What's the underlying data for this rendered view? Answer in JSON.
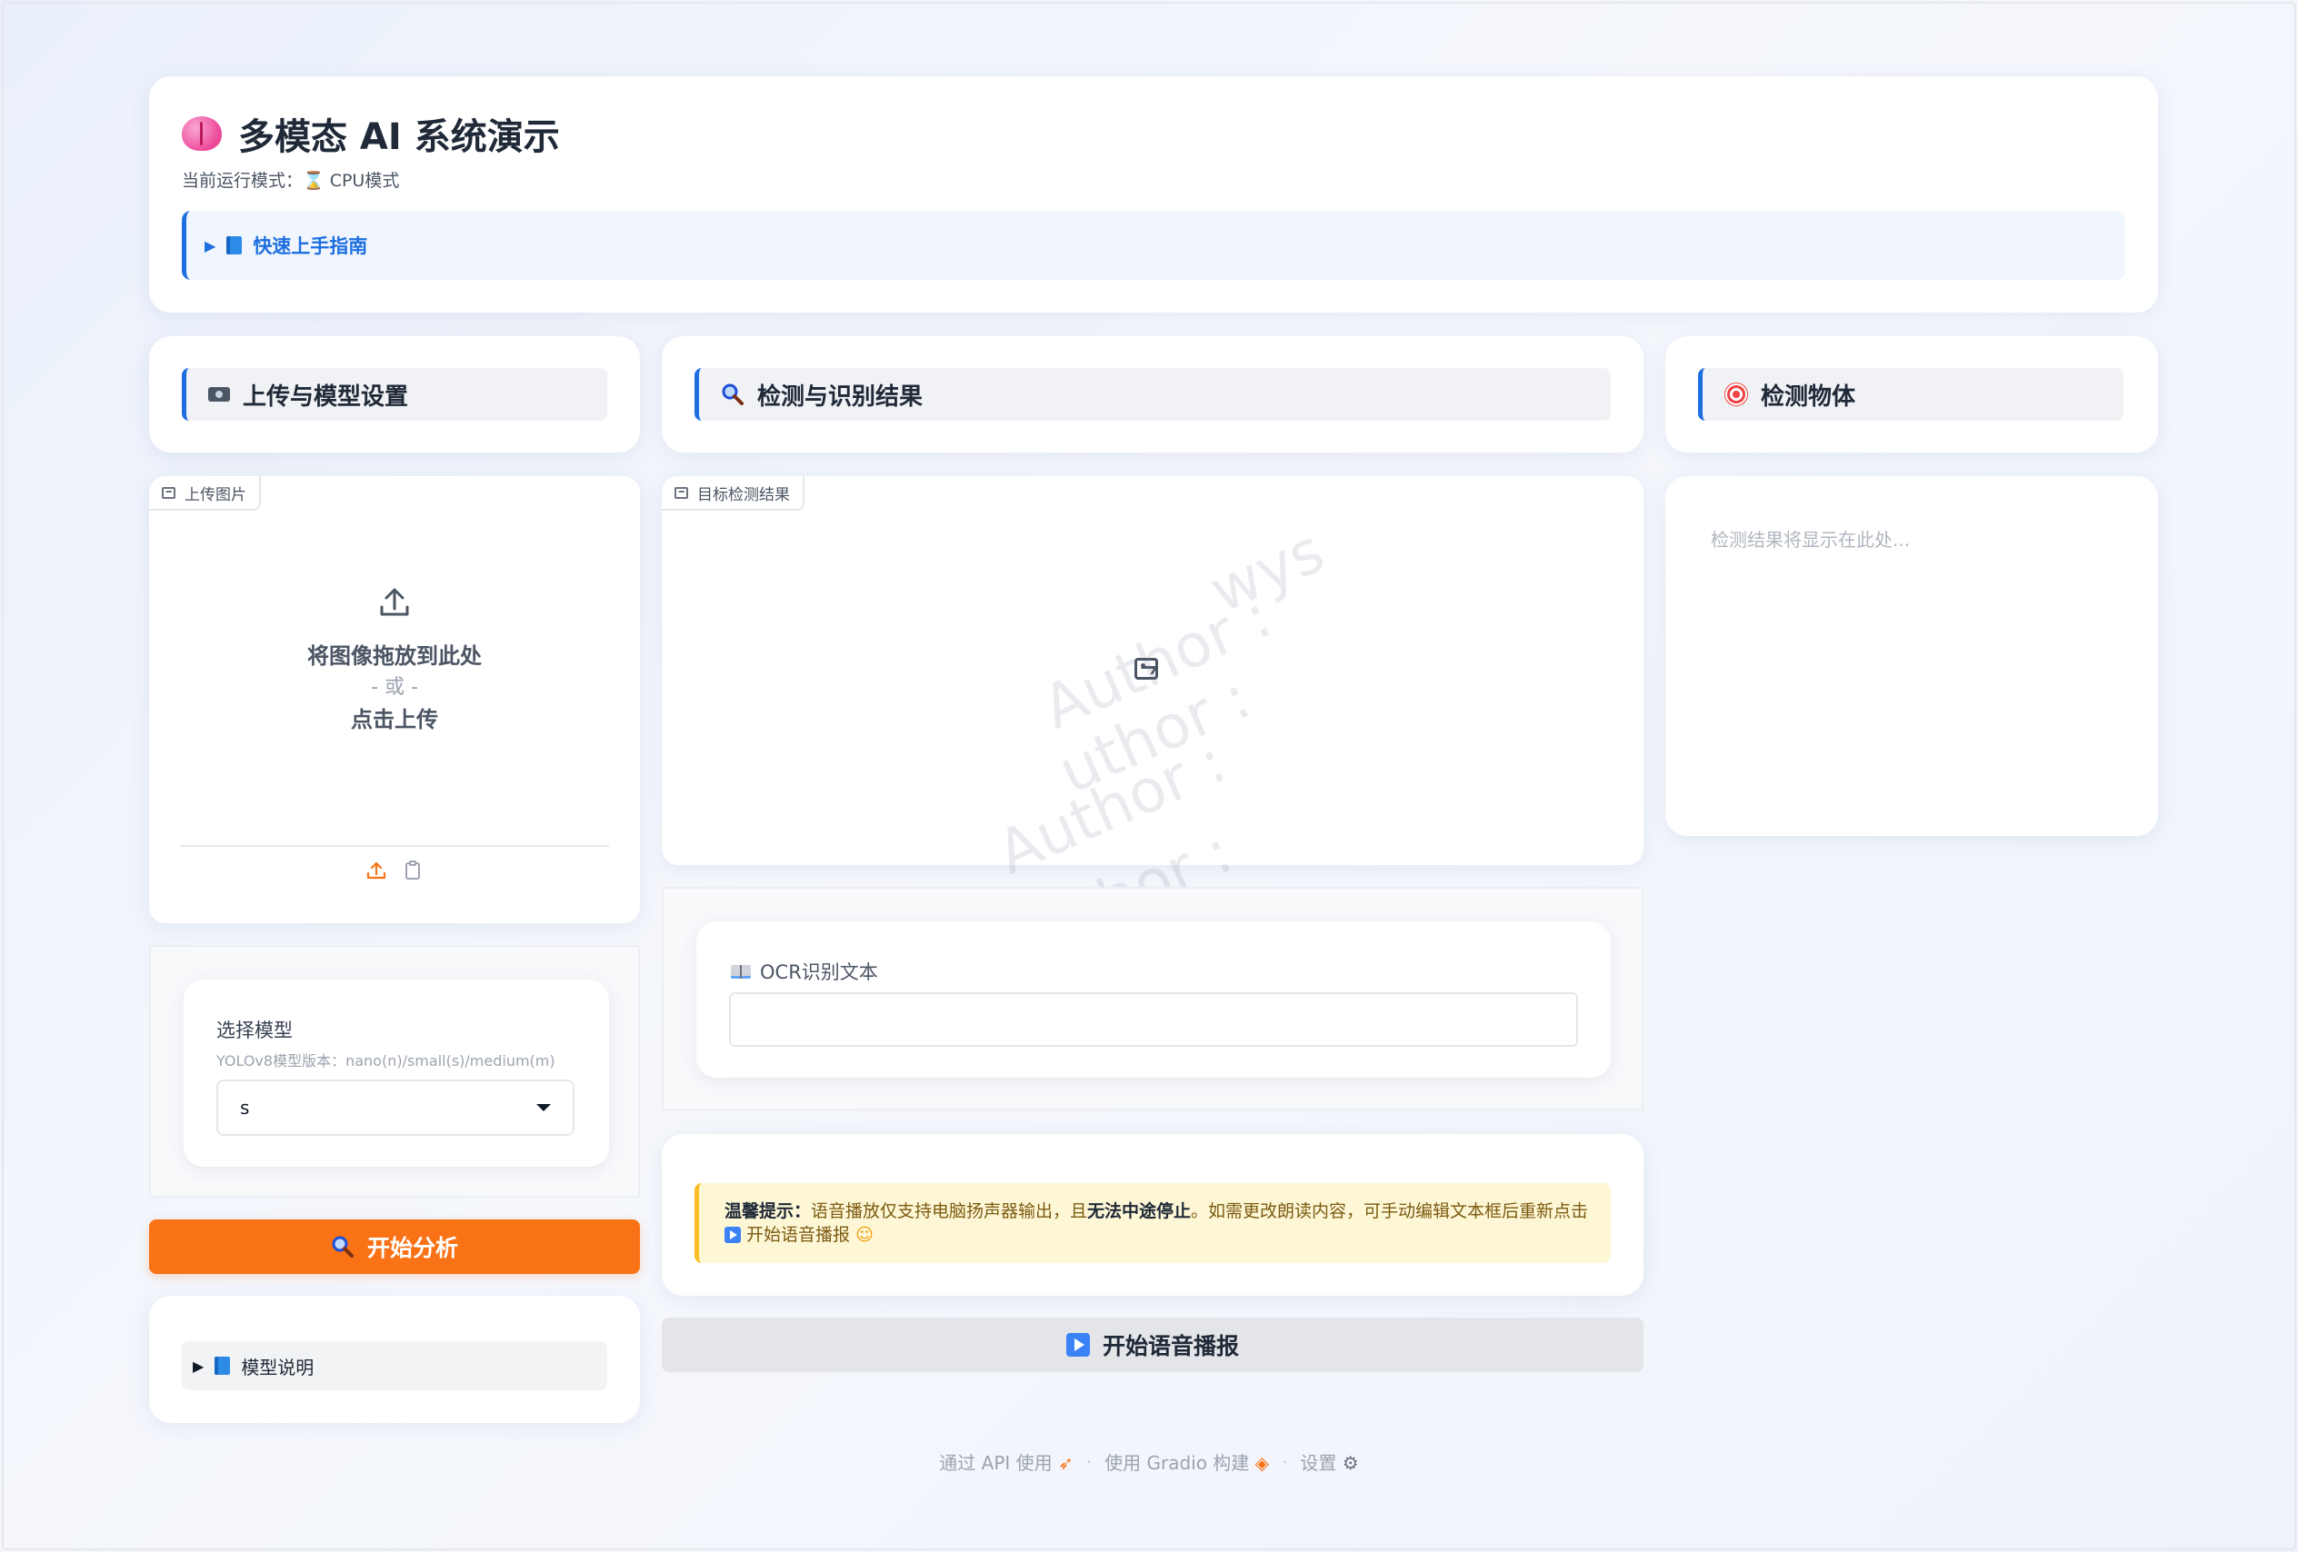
{
  "header": {
    "title": "多模态 AI 系统演示",
    "run_mode": "当前运行模式：⌛ CPU模式",
    "guide_label": "快速上手指南"
  },
  "upload_section": {
    "title": "上传与模型设置",
    "panel_label": "上传图片",
    "drop_text": "将图像拖放到此处",
    "or_text": "- 或 -",
    "click_text": "点击上传"
  },
  "model": {
    "label": "选择模型",
    "info": "YOLOv8模型版本：nano(n)/small(s)/medium(m)",
    "selected": "s"
  },
  "analyze_button": "开始分析",
  "model_desc_label": "模型说明",
  "results_section": {
    "title": "检测与识别结果",
    "panel_label": "目标检测结果",
    "watermark": [
      "wys",
      "Author :",
      "uthor :",
      "Author :",
      "uthor :",
      "uthor"
    ]
  },
  "ocr": {
    "label": "OCR识别文本",
    "value": ""
  },
  "tip": {
    "bold_prefix": "温馨提示：",
    "text1": "语音播放仅支持电脑扬声器输出，且",
    "bold_mid": "无法中途停止",
    "text2": "。如需更改朗读内容，可手动编辑文本框后重新点击",
    "text3": "开始语音播报"
  },
  "speak_button": "开始语音播报",
  "objects_section": {
    "title": "检测物体",
    "placeholder": "检测结果将显示在此处..."
  },
  "footer": {
    "api": "通过 API 使用",
    "built": "使用 Gradio 构建",
    "settings": "设置",
    "sep": "·"
  }
}
